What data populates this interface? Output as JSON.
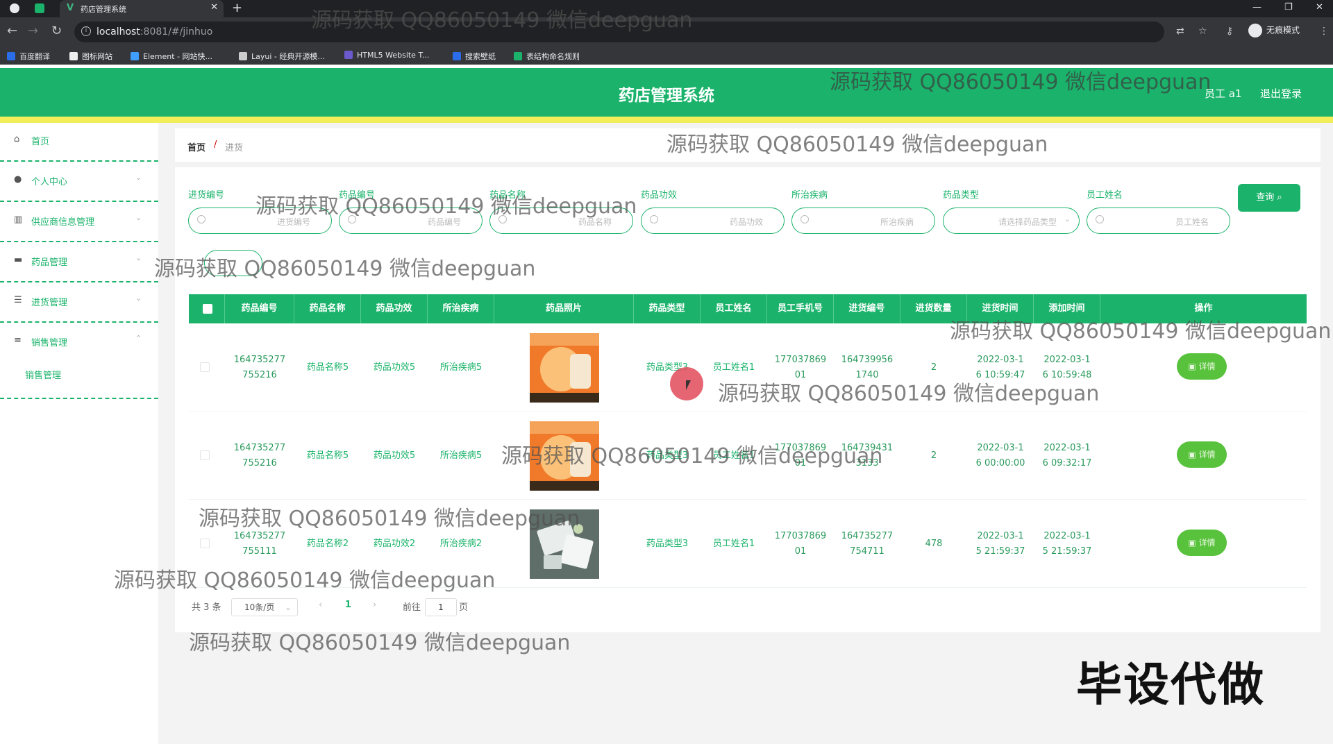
{
  "browser": {
    "tab_title": "药店管理系统",
    "tab_close": "✕",
    "new_tab": "+",
    "url_host": "localhost",
    "url_rest": ":8081/#/jinhuo",
    "incognito_label": "无痕模式",
    "window_controls": [
      "—",
      "❐",
      "✕"
    ],
    "bookmarks": [
      {
        "label": "百度翻译",
        "color": "#2b6de8"
      },
      {
        "label": "图标网站",
        "color": "#222"
      },
      {
        "label": "Element - 网站快...",
        "color": "#409eff"
      },
      {
        "label": "Layui - 经典开源模...",
        "color": "#333"
      },
      {
        "label": "HTML5 Website T...",
        "color": "#6a5acd"
      },
      {
        "label": "搜索壁纸",
        "color": "#2b6de8"
      },
      {
        "label": "表结构命名规则",
        "color": "#1bb36b"
      }
    ]
  },
  "header": {
    "title": "药店管理系统",
    "user": "员工 a1",
    "logout": "退出登录",
    "bg_color": "#1bb36b",
    "strip_color": "#f1ee5a"
  },
  "sidebar": {
    "items": [
      {
        "label": "首页",
        "icon": "home-icon"
      },
      {
        "label": "个人中心",
        "icon": "user-icon",
        "arrow": "⌄"
      },
      {
        "label": "供应商信息管理",
        "icon": "chart-icon",
        "arrow": "⌄"
      },
      {
        "label": "药品管理",
        "icon": "monitor-icon",
        "arrow": "⌄"
      },
      {
        "label": "进货管理",
        "icon": "list-icon",
        "arrow": "⌄"
      },
      {
        "label": "销售管理",
        "icon": "sliders-icon",
        "arrow": "⌃"
      }
    ],
    "sub_item": "销售管理"
  },
  "breadcrumb": {
    "home": "首页",
    "separator": "/",
    "current": "进货"
  },
  "filters": [
    {
      "label": "进货编号",
      "placeholder": "进货编号"
    },
    {
      "label": "药品编号",
      "placeholder": "药品编号"
    },
    {
      "label": "药品名称",
      "placeholder": "药品名称"
    },
    {
      "label": "药品功效",
      "placeholder": "药品功效"
    },
    {
      "label": "所治疾病",
      "placeholder": "所治疾病"
    },
    {
      "label": "药品类型",
      "placeholder": "请选择药品类型"
    },
    {
      "label": "员工姓名",
      "placeholder": "员工姓名"
    }
  ],
  "query_button": "查询 ⌕",
  "table": {
    "columns": [
      "药品编号",
      "药品名称",
      "药品功效",
      "所治疾病",
      "药品照片",
      "药品类型",
      "员工姓名",
      "员工手机号",
      "进货编号",
      "进货数量",
      "进货时间",
      "添加时间",
      "操作"
    ],
    "rows": [
      {
        "code": "164735277\n755216",
        "name": "药品名称5",
        "effect": "药品功效5",
        "disease": "所治疾病5",
        "type": "药品类型3",
        "employee": "员工姓名1",
        "phone": "177037869\n01",
        "purchase_no": "164739956\n1740",
        "qty": "2",
        "purchase_time": "2022-03-1\n6 10:59:47",
        "add_time": "2022-03-1\n6 10:59:48",
        "action": "▣ 详情"
      },
      {
        "code": "164735277\n755216",
        "name": "药品名称5",
        "effect": "药品功效5",
        "disease": "所治疾病5",
        "type": "药品类型3",
        "employee": "员工姓名1",
        "phone": "177037869\n01",
        "purchase_no": "164739431\n3133",
        "qty": "2",
        "purchase_time": "2022-03-1\n6 00:00:00",
        "add_time": "2022-03-1\n6 09:32:17",
        "action": "▣ 详情"
      },
      {
        "code": "164735277\n755111",
        "name": "药品名称2",
        "effect": "药品功效2",
        "disease": "所治疾病2",
        "type": "药品类型3",
        "employee": "员工姓名1",
        "phone": "177037869\n01",
        "purchase_no": "164735277\n754711",
        "qty": "478",
        "purchase_time": "2022-03-1\n5 21:59:37",
        "add_time": "2022-03-1\n5 21:59:37",
        "action": "▣ 详情"
      }
    ]
  },
  "pagination": {
    "total": "共 3 条",
    "page_size": "10条/页",
    "prev": "‹",
    "current": "1",
    "next": "›",
    "goto": "前往",
    "goto_value": "1",
    "page_unit": "页"
  },
  "watermark": "源码获取 QQ86050149 微信deepguan",
  "corner_text": "毕设代做"
}
